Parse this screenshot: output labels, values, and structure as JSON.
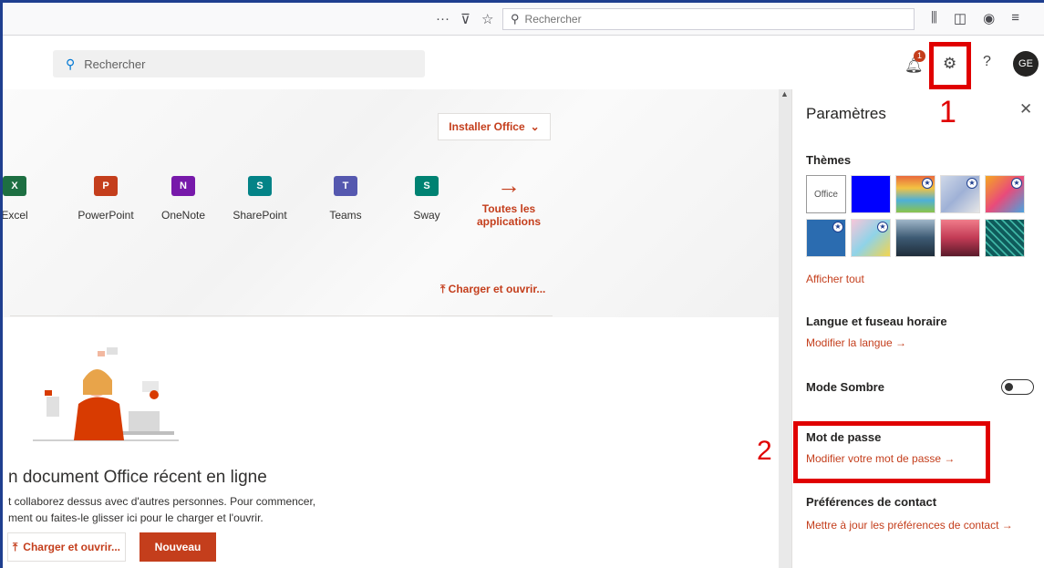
{
  "browser": {
    "search_placeholder": "Rechercher",
    "icons": [
      "more-icon",
      "pocket-icon",
      "bookmark-star-icon",
      "library-icon",
      "sidebar-icon",
      "account-icon",
      "menu-icon"
    ]
  },
  "header": {
    "search_placeholder": "Rechercher",
    "notification_count": "1",
    "avatar_initials": "GE",
    "help_label": "?"
  },
  "main": {
    "install_office": "Installer Office",
    "apps": [
      {
        "name": "Excel",
        "letter": "X",
        "color": "#1d6f42"
      },
      {
        "name": "PowerPoint",
        "letter": "P",
        "color": "#c43e1c"
      },
      {
        "name": "OneNote",
        "letter": "N",
        "color": "#7719aa"
      },
      {
        "name": "SharePoint",
        "letter": "S",
        "color": "#038387"
      },
      {
        "name": "Teams",
        "letter": "T",
        "color": "#5558af"
      },
      {
        "name": "Sway",
        "letter": "S",
        "color": "#008272"
      }
    ],
    "all_apps_line1": "Toutes les",
    "all_apps_line2": "applications",
    "upload_open": "Charger et ouvrir...",
    "empty_title": "n document Office récent en ligne",
    "empty_desc_line1": "t collaborez dessus avec d'autres personnes. Pour commencer,",
    "empty_desc_line2": "ment ou faites-le glisser ici pour le charger et l'ouvrir.",
    "btn_upload": "Charger et ouvrir...",
    "btn_new": "Nouveau"
  },
  "settings": {
    "title": "Paramètres",
    "themes_label": "Thèmes",
    "office_theme": "Office",
    "show_all": "Afficher tout",
    "language_label": "Langue et fuseau horaire",
    "language_link": "Modifier la langue →",
    "dark_mode_label": "Mode Sombre",
    "dark_mode_on": false,
    "password_label": "Mot de passe",
    "password_link": "Modifier votre mot de passe →",
    "contact_label": "Préférences de contact",
    "contact_link": "Mettre à jour les préférences de contact →"
  },
  "annotations": {
    "step1": "1",
    "step2": "2",
    "highlight_color": "#e00000"
  },
  "colors": {
    "accent": "#c43e1c",
    "frame": "#1f3f8f"
  }
}
